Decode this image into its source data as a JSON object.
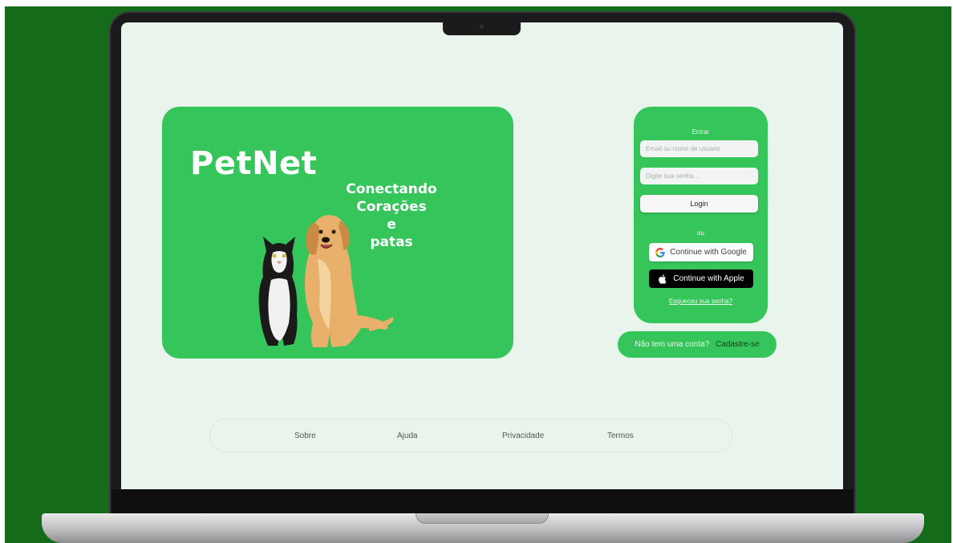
{
  "hero": {
    "brand": "PetNet",
    "tagline": [
      "Conectando",
      "Corações",
      "e",
      "patas"
    ]
  },
  "login": {
    "title": "Entrar",
    "email_placeholder": "Email ou nome de usuario",
    "password_placeholder": "Digite sua senha...",
    "login_button": "Login",
    "or_label": "ou",
    "google_button": "Continue with Google",
    "apple_button": "Continue with Apple",
    "forgot_link": "Esqueceu sua senha?"
  },
  "signup": {
    "question": "Não tem uma conta?",
    "link": "Cadastre-se"
  },
  "footer": {
    "links": [
      "Sobre",
      "Ajuda",
      "Privacidade",
      "Termos"
    ]
  },
  "colors": {
    "background": "#146b1a",
    "screen": "#e9f4ec",
    "card_green": "#35c55a",
    "signup_link": "#0f3d1a"
  },
  "icons": [
    "google-icon",
    "apple-icon"
  ]
}
